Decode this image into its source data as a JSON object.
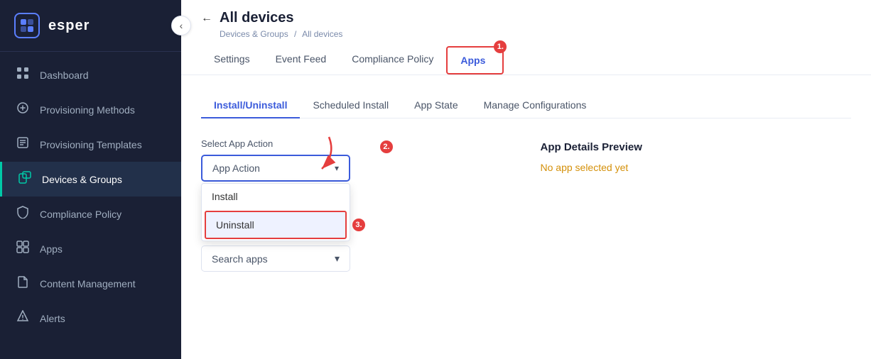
{
  "sidebar": {
    "logo": "esper",
    "items": [
      {
        "id": "dashboard",
        "label": "Dashboard",
        "icon": "⊞",
        "active": false
      },
      {
        "id": "provisioning-methods",
        "label": "Provisioning Methods",
        "icon": "🔗",
        "active": false
      },
      {
        "id": "provisioning-templates",
        "label": "Provisioning Templates",
        "icon": "☰",
        "active": false
      },
      {
        "id": "devices-groups",
        "label": "Devices & Groups",
        "icon": "📱",
        "active": true
      },
      {
        "id": "compliance-policy",
        "label": "Compliance Policy",
        "icon": "🛡",
        "active": false
      },
      {
        "id": "apps",
        "label": "Apps",
        "icon": "⊞",
        "active": false
      },
      {
        "id": "content-management",
        "label": "Content Management",
        "icon": "📄",
        "active": false
      },
      {
        "id": "alerts",
        "label": "Alerts",
        "icon": "🔔",
        "active": false
      }
    ]
  },
  "header": {
    "back_label": "←",
    "title": "All devices",
    "breadcrumb_part1": "Devices & Groups",
    "breadcrumb_sep": "/",
    "breadcrumb_part2": "All devices"
  },
  "main_tabs": [
    {
      "id": "settings",
      "label": "Settings",
      "active": false,
      "highlighted": false
    },
    {
      "id": "event-feed",
      "label": "Event Feed",
      "active": false,
      "highlighted": false
    },
    {
      "id": "compliance-policy",
      "label": "Compliance Policy",
      "active": false,
      "highlighted": false
    },
    {
      "id": "apps",
      "label": "Apps",
      "active": true,
      "highlighted": true
    }
  ],
  "sub_tabs": [
    {
      "id": "install-uninstall",
      "label": "Install/Uninstall",
      "active": true
    },
    {
      "id": "scheduled-install",
      "label": "Scheduled Install",
      "active": false
    },
    {
      "id": "app-state",
      "label": "App State",
      "active": false
    },
    {
      "id": "manage-configurations",
      "label": "Manage Configurations",
      "active": false
    }
  ],
  "select_app_action": {
    "label": "Select App Action",
    "placeholder": "App Action",
    "options": [
      {
        "value": "install",
        "label": "Install",
        "highlighted": false
      },
      {
        "value": "uninstall",
        "label": "Uninstall",
        "highlighted": true
      }
    ]
  },
  "search_apps": {
    "placeholder": "Search apps"
  },
  "app_details": {
    "title": "App Details Preview",
    "empty_message": "No app selected yet"
  },
  "annotations": {
    "step1": "1.",
    "step2": "2.",
    "step3": "3."
  },
  "collapse_icon": "‹",
  "colors": {
    "active_nav": "#00c9a7",
    "primary_blue": "#3b5bdb",
    "alert_red": "#e53e3e",
    "orange_text": "#d4900a",
    "sidebar_bg": "#1a2035"
  }
}
